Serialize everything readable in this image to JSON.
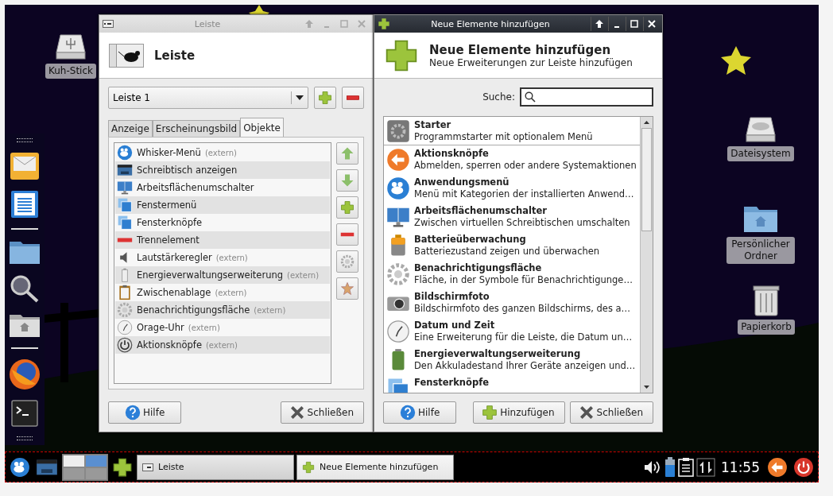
{
  "desktop_icons": [
    {
      "label": "Kuh-Stick"
    },
    {
      "label": "Dateisystem"
    },
    {
      "label": "Persönlicher Ordner"
    },
    {
      "label": "Papierkorb"
    }
  ],
  "panel_window": {
    "title": "Leiste",
    "active": false,
    "header": "Leiste",
    "panel_select": {
      "value": "Leiste 1"
    },
    "tabs": [
      {
        "label": "Anzeige",
        "selected": false
      },
      {
        "label": "Erscheinungsbild",
        "selected": false
      },
      {
        "label": "Objekte",
        "selected": true
      }
    ],
    "items": [
      {
        "name": "Whisker-Menü",
        "note": "(extern)"
      },
      {
        "name": "Schreibtisch anzeigen"
      },
      {
        "name": "Arbeitsflächenumschalter"
      },
      {
        "name": "Fenstermenü"
      },
      {
        "name": "Fensterknöpfe"
      },
      {
        "name": "Trennelement"
      },
      {
        "name": "Lautstärkeregler",
        "note": "(extern)"
      },
      {
        "name": "Energieverwaltungserweiterung",
        "note": "(extern)"
      },
      {
        "name": "Zwischenablage",
        "note": "(extern)"
      },
      {
        "name": "Benachrichtigungsfläche",
        "note": "(extern)"
      },
      {
        "name": "Orage-Uhr",
        "note": "(extern)"
      },
      {
        "name": "Aktionsknöpfe",
        "note": "(extern)"
      }
    ],
    "buttons": [
      "Hilfe",
      "Schließen"
    ]
  },
  "add_window": {
    "title": "Neue Elemente hinzufügen",
    "active": true,
    "header": "Neue Elemente hinzufügen",
    "subtitle": "Neue Erweiterungen zur Leiste hinzufügen",
    "search_label": "Suche:",
    "plugins": [
      {
        "name": "Starter",
        "description": "Programmstarter mit optionalem Menü"
      },
      {
        "name": "Aktionsknöpfe",
        "description": "Abmelden, sperren oder andere Systemaktionen"
      },
      {
        "name": "Anwendungsmenü",
        "description": "Menü mit Kategorien der installierten Anwend…"
      },
      {
        "name": "Arbeitsflächenumschalter",
        "description": "Zwischen virtuellen Schreibtischen umschalten"
      },
      {
        "name": "Batterieüberwachung",
        "description": "Batteriezustand zeigen und überwachen"
      },
      {
        "name": "Benachrichtigungsfläche",
        "description": "Fläche, in der Symbole für Benachrichtigunge…"
      },
      {
        "name": "Bildschirmfoto",
        "description": "Bildschirmfoto des ganzen Bildschirms, des a…"
      },
      {
        "name": "Datum und Zeit",
        "description": "Eine Erweiterung für die Leiste, die Datum un…"
      },
      {
        "name": "Energieverwaltungserweiterung",
        "description": "Den Akkuladestand Ihrer Geräte anzeigen und…"
      },
      {
        "name": "Fensterknöpfe"
      }
    ],
    "buttons": [
      "Hilfe",
      "Hinzufügen",
      "Schließen"
    ]
  },
  "taskbar": {
    "tasks": [
      {
        "label": "Leiste",
        "selected": false
      },
      {
        "label": "Neue Elemente hinzufügen",
        "selected": true
      }
    ],
    "clock": "11:55"
  }
}
